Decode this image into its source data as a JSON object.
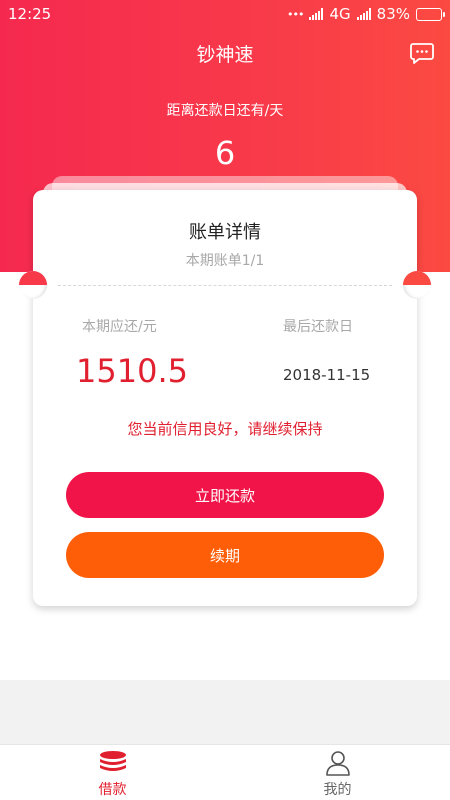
{
  "status_bar": {
    "time": "12:25",
    "dots": "•••",
    "network": "4G",
    "battery_percent": "83%",
    "battery_level": 0.83
  },
  "header": {
    "title": "钞神速",
    "message_icon": "chat-bubble-icon"
  },
  "due": {
    "label": "距离还款日还有/天",
    "days": "6"
  },
  "card": {
    "title": "账单详情",
    "subtitle": "本期账单1/1",
    "amount_label": "本期应还/元",
    "amount": "1510.5",
    "date_label": "最后还款日",
    "date": "2018-11-15",
    "credit_message": "您当前信用良好，请继续保持",
    "repay_button": "立即还款",
    "renew_button": "续期"
  },
  "tabs": [
    {
      "label": "借款",
      "icon": "coin-stack-icon",
      "active": true
    },
    {
      "label": "我的",
      "icon": "user-icon",
      "active": false
    }
  ],
  "colors": {
    "brand_red": "#f5294f",
    "accent_red": "#e0202f",
    "button_red": "#f01448",
    "button_orange": "#fe5e08"
  }
}
